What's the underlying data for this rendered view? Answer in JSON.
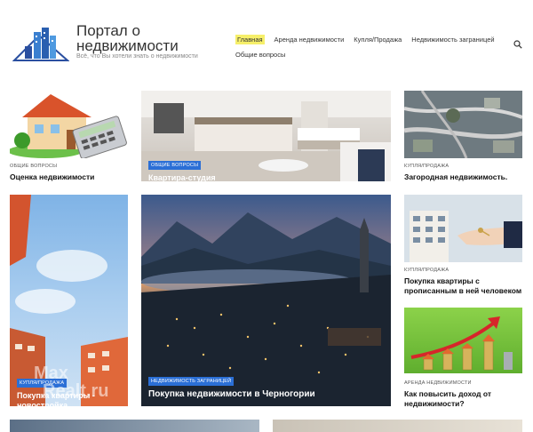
{
  "site": {
    "title": "Портал о недвижимости",
    "description": "Всё, что Вы хотели знать о недвижимости"
  },
  "nav": {
    "row1": [
      "Главная",
      "Аренда недвижимости",
      "Купля/Продажа",
      "Недвижимость заграницей"
    ],
    "row2": [
      "Общие вопросы"
    ]
  },
  "icons": {
    "search": "search-icon",
    "logo": "house-logo-icon"
  },
  "cards": {
    "c1": {
      "category": "ОБЩИЕ ВОПРОСЫ",
      "title": "Оценка недвижимости"
    },
    "c2": {
      "category": "ОБЩИЕ ВОПРОСЫ",
      "title": "Квартира-студия"
    },
    "c3": {
      "category": "КУПЛЯ/ПРОДАЖА",
      "title": "Загородная недвижимость."
    },
    "c4": {
      "category": "КУПЛЯ/ПРОДАЖА",
      "title": "Покупка квартиры - новостройка"
    },
    "c5": {
      "category": "НЕДВИЖИМОСТЬ ЗАГРАНИЦЕЙ",
      "title": "Покупка недвижимости в Черногории"
    },
    "c6": {
      "category": "КУПЛЯ/ПРОДАЖА",
      "title": "Покупка квартиры с прописанным в ней человеком"
    },
    "c7": {
      "category": "АРЕНДА НЕДВИЖИМОСТИ",
      "title": "Как повысить доход от недвижимости?"
    }
  },
  "watermark": {
    "line1": "Max",
    "line2": "Realt.ru"
  },
  "colors": {
    "accent": "#2b6fd6",
    "nav_highlight": "#f6ef6a"
  }
}
